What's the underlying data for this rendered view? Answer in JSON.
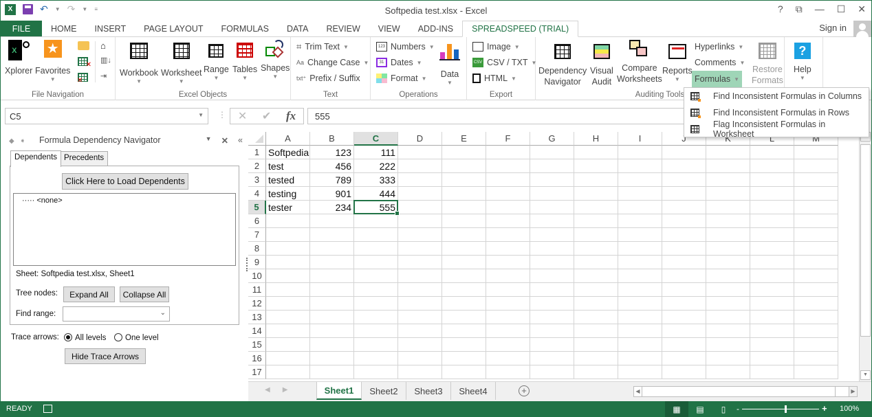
{
  "window": {
    "title": "Softpedia test.xlsx - Excel",
    "controls": {
      "help": "?",
      "ribbon_display": "⧉",
      "minimize": "—",
      "maximize": "☐",
      "close": "✕"
    }
  },
  "qat": {
    "undo": "↶",
    "redo": "↷",
    "customize": "≡"
  },
  "tabs": [
    "FILE",
    "HOME",
    "INSERT",
    "PAGE LAYOUT",
    "FORMULAS",
    "DATA",
    "REVIEW",
    "VIEW",
    "ADD-INS",
    "SPREADSPEED (TRIAL)"
  ],
  "active_tab": "SPREADSPEED (TRIAL)",
  "account": {
    "sign_in": "Sign in"
  },
  "ribbon": {
    "file_navigation": {
      "label": "File Navigation",
      "xplorer": "Xplorer",
      "favorites": "Favorites"
    },
    "excel_objects": {
      "label": "Excel Objects",
      "workbook": "Workbook",
      "worksheet": "Worksheet",
      "range": "Range",
      "tables": "Tables",
      "shapes": "Shapes"
    },
    "text": {
      "label": "Text",
      "trim_text": "Trim Text",
      "change_case": "Change Case",
      "prefix_suffix": "Prefix / Suffix"
    },
    "operations": {
      "label": "Operations",
      "numbers": "Numbers",
      "dates": "Dates",
      "format": "Format",
      "data": "Data"
    },
    "export": {
      "label": "Export",
      "image": "Image",
      "csv_txt": "CSV / TXT",
      "html": "HTML"
    },
    "auditing_tools": {
      "label": "Auditing Tools",
      "dependency_navigator_1": "Dependency",
      "dependency_navigator_2": "Navigator",
      "visual_audit_1": "Visual",
      "visual_audit_2": "Audit",
      "compare_worksheets_1": "Compare",
      "compare_worksheets_2": "Worksheets",
      "reports": "Reports",
      "hyperlinks": "Hyperlinks",
      "comments": "Comments",
      "formulas": "Formulas"
    },
    "restore_formats_1": "Restore",
    "restore_formats_2": "Formats",
    "help": "Help"
  },
  "formulas_menu": [
    "Find Inconsistent Formulas in Columns",
    "Find Inconsistent Formulas in Rows",
    "Flag Inconsistent Formulas in Worksheet"
  ],
  "formula_bar": {
    "name_box": "C5",
    "value": "555",
    "fx": "fx",
    "cancel": "✕",
    "enter": "✔"
  },
  "pane": {
    "title": "Formula Dependency Navigator",
    "tabs": [
      "Dependents",
      "Precedents"
    ],
    "load_button": "Click Here to Load Dependents",
    "tree_node": "····· <none>",
    "sheet_info": "Sheet: Softpedia test.xlsx, Sheet1",
    "tree_nodes_label": "Tree nodes:",
    "expand_all": "Expand All",
    "collapse_all": "Collapse All",
    "find_range_label": "Find range:",
    "find_range_value": "",
    "trace_arrows_label": "Trace arrows:",
    "trace_options": [
      "All levels",
      "One level"
    ],
    "trace_selected": "All levels",
    "hide_trace_arrows": "Hide Trace Arrows"
  },
  "sheet": {
    "columns": [
      "A",
      "B",
      "C",
      "D",
      "E",
      "F",
      "G",
      "H",
      "I",
      "J",
      "K",
      "L",
      "M"
    ],
    "selected_column": "C",
    "selected_row": 5,
    "rows": [
      [
        "Softpedia",
        "123",
        "111"
      ],
      [
        "test",
        "456",
        "222"
      ],
      [
        "tested",
        "789",
        "333"
      ],
      [
        "testing",
        "901",
        "444"
      ],
      [
        "tester",
        "234",
        "555"
      ]
    ],
    "row_count_visible": 17
  },
  "sheet_tabs": [
    "Sheet1",
    "Sheet2",
    "Sheet3",
    "Sheet4"
  ],
  "active_sheet": "Sheet1",
  "status": {
    "mode": "READY",
    "zoom": "100%",
    "zoom_minus": "-",
    "zoom_plus": "+"
  }
}
